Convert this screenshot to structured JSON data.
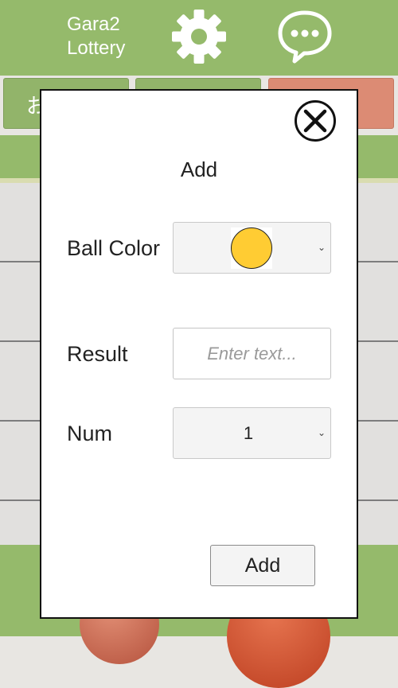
{
  "header": {
    "app_title": "Gara2\nLottery",
    "settings_icon": "gear-icon",
    "chat_icon": "chat-bubble-icon",
    "background_color": "#95ba6b"
  },
  "toolbar": {
    "button_1_label": "お",
    "button_1_color": "#92b46a",
    "button_2_color": "#92b46a",
    "button_3_color": "#dc8b74"
  },
  "modal": {
    "title": "Add",
    "close_icon": "close-circle-icon",
    "ball_color": {
      "label": "Ball Color",
      "selected_color": "#ffcc33"
    },
    "result": {
      "label": "Result",
      "placeholder": "Enter text...",
      "value": ""
    },
    "num": {
      "label": "Num",
      "value": "1"
    },
    "add_button_label": "Add"
  }
}
